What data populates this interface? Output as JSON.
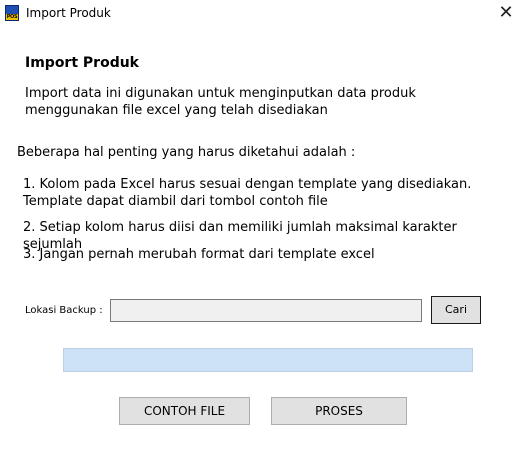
{
  "window": {
    "title": "Import Produk",
    "app_icon": "pos-app-icon",
    "app_icon_text": "POS",
    "close_glyph": "✕",
    "close_icon": "close-icon"
  },
  "content": {
    "heading": "Import Produk",
    "description": "Import data ini digunakan untuk menginputkan data produk menggunakan file excel yang telah disediakan",
    "intro": "Beberapa hal penting yang harus diketahui adalah :",
    "notes": [
      "1. Kolom pada Excel harus sesuai dengan template yang disediakan. Template dapat diambil dari tombol contoh file",
      "2. Setiap kolom harus diisi dan memiliki jumlah maksimal karakter sejumlah",
      "3. Jangan pernah merubah format dari template excel"
    ]
  },
  "form": {
    "lokasi_label": "Lokasi Backup :",
    "lokasi_value": "",
    "cari_label": "Cari"
  },
  "progress": {
    "value_percent": 0,
    "track_color": "#cde1f7",
    "fill_color": "#06b025"
  },
  "buttons": {
    "contoh_file": "CONTOH FILE",
    "proses": "PROSES"
  }
}
